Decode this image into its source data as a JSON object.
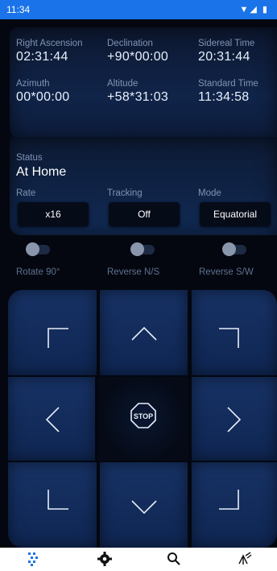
{
  "status_bar": {
    "time": "11:34",
    "icons": "▼◢ ▮"
  },
  "info": {
    "right_ascension": {
      "label": "Right Ascension",
      "value": "02:31:44"
    },
    "declination": {
      "label": "Declination",
      "value": "+90*00:00"
    },
    "sidereal_time": {
      "label": "Sidereal Time",
      "value": "20:31:44"
    },
    "azimuth": {
      "label": "Azimuth",
      "value": "00*00:00"
    },
    "altitude": {
      "label": "Altitude",
      "value": "+58*31:03"
    },
    "standard_time": {
      "label": "Standard Time",
      "value": "11:34:58"
    }
  },
  "status": {
    "label": "Status",
    "value": "At Home",
    "rate_label": "Rate",
    "rate_value": "x16",
    "tracking_label": "Tracking",
    "tracking_value": "Off",
    "mode_label": "Mode",
    "mode_value": "Equatorial"
  },
  "toggles": [
    {
      "label": "Rotate 90°",
      "on": false
    },
    {
      "label": "Reverse N/S",
      "on": false
    },
    {
      "label": "Reverse S/W",
      "on": false
    }
  ],
  "pad": {
    "stop_label": "STOP"
  },
  "nav": [
    "dots-grid-icon",
    "gear-icon",
    "search-icon",
    "telescope-icon"
  ],
  "colors": {
    "accent": "#1a73e8",
    "panel": "#112a55",
    "key": "#173265"
  }
}
